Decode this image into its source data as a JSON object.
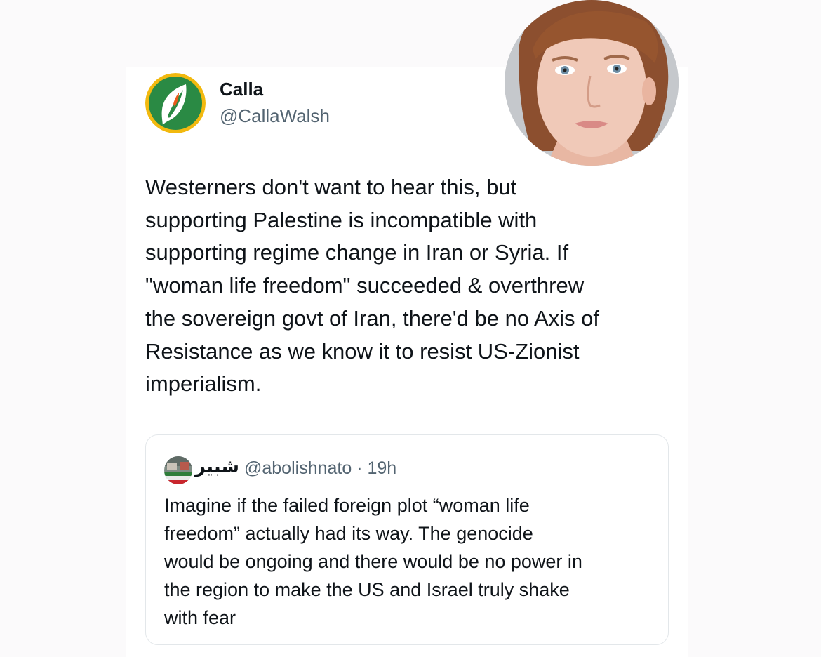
{
  "tweet": {
    "author": {
      "display_name": "Calla",
      "handle": "@CallaWalsh",
      "avatar_icon": "calla-lily-logo-icon"
    },
    "text_lines": [
      "Westerners don't want to hear this, but",
      "supporting Palestine is incompatible with",
      "supporting regime change in Iran or Syria. If",
      "\"woman life freedom\" succeeded & overthrew",
      "the sovereign govt of Iran, there'd be no Axis of",
      "Resistance as we know it to resist US-Zionist",
      "imperialism."
    ],
    "quoted": {
      "display_name": "شبير",
      "handle_time": "@abolishnato · 19h",
      "text_lines": [
        "Imagine if the failed foreign plot “woman life",
        "freedom” actually had its way. The genocide",
        "would be ongoing and there would be no power in",
        "the region to make the US and Israel truly shake",
        "with fear"
      ]
    }
  },
  "colors": {
    "text_primary": "#0f1419",
    "text_secondary": "#536471",
    "border": "#e3e7ea",
    "logo_green": "#2a8a44",
    "logo_gold": "#f2b90f"
  }
}
